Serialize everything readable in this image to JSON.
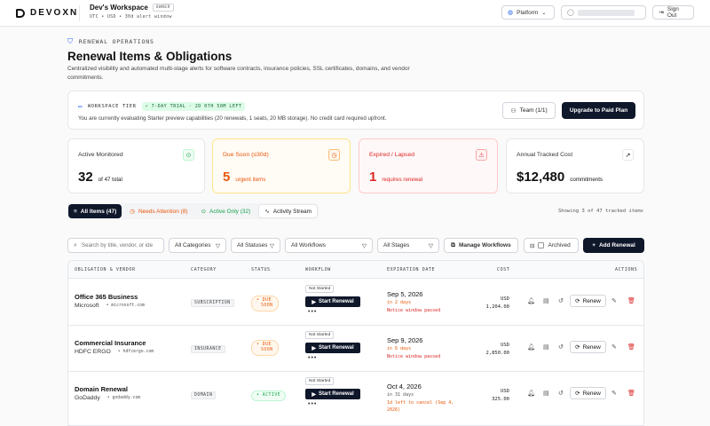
{
  "app": {
    "logo": "DEVOXN",
    "workspace": "Dev's Workspace",
    "role_badge": "OWNER",
    "workspace_sub": "UTC • USD • 30d alert window"
  },
  "header": {
    "platform": "Platform",
    "sign_out": "Sign Out"
  },
  "section_label": "RENEWAL OPERATIONS",
  "page_title": "Renewal Items & Obligations",
  "page_desc": "Centralized visibility and automated multi-stage alerts for software contracts, insurance policies, SSL certificates, domains, and vendor commitments.",
  "tier": {
    "label": "WORKSPACE TIER",
    "trial": "7-DAY TRIAL · 2D 07H 50M LEFT",
    "desc": "You are currently evaluating Starter preview capabilities (20 renewals, 1 seats, 20 MB storage). No credit card required upfront.",
    "team_button": "Team (1/1)",
    "upgrade_button": "Upgrade to Paid Plan"
  },
  "stats": [
    {
      "label": "Active Monitored",
      "value": "32",
      "suffix": "of 47 total"
    },
    {
      "label": "Due Soon (≤30d)",
      "value": "5",
      "suffix": "urgent items"
    },
    {
      "label": "Expired / Lapsed",
      "value": "1",
      "suffix": "requires renewal"
    },
    {
      "label": "Annual Tracked Cost",
      "value": "$12,480",
      "suffix": "commitments"
    }
  ],
  "tabs": [
    {
      "label": "All Items (47)"
    },
    {
      "label": "Needs Attention (8)"
    },
    {
      "label": "Active Only (32)"
    },
    {
      "label": "Activity Stream"
    }
  ],
  "showing": "Showing 3 of 47 tracked items",
  "filters": {
    "search_placeholder": "Search by title, vendor, or ide",
    "categories": "All Categories",
    "statuses": "All Statuses",
    "workflows": "All Workflows",
    "stages": "All Stages",
    "manage_workflows": "Manage Workflows",
    "archived": "Archived",
    "add_renewal": "Add Renewal"
  },
  "table": {
    "headers": {
      "obligation": "OBLIGATION & VENDOR",
      "category": "CATEGORY",
      "status": "STATUS",
      "workflow": "WORKFLOW",
      "expiration": "EXPIRATION DATE",
      "cost": "COST",
      "actions": "ACTIONS"
    },
    "rows": [
      {
        "name": "Office 365 Business",
        "vendor": "Microsoft",
        "domain": "• microsoft.com",
        "category": "SUBSCRIPTION",
        "status_line1": "• DUE",
        "status_line2": "SOON",
        "wf_status": "Not Started",
        "wf_button": "Start Renewal",
        "wf_more": "•••",
        "date": "Sep 5, 2026",
        "in": "in 2 days",
        "note": "Notice window passed",
        "currency": "USD",
        "amount": "1,204.00",
        "renew": "Renew"
      },
      {
        "name": "Commercial Insurance",
        "vendor": "HDFC ERGO",
        "domain": "• hdfcergo.com",
        "category": "INSURANCE",
        "status_line1": "• DUE",
        "status_line2": "SOON",
        "wf_status": "Not Started",
        "wf_button": "Start Renewal",
        "wf_more": "•••",
        "date": "Sep 9, 2026",
        "in": "in 6 days",
        "note": "Notice window passed",
        "currency": "USD",
        "amount": "2,850.00",
        "renew": "Renew"
      },
      {
        "name": "Domain Renewal",
        "vendor": "GoDaddy",
        "domain": "• godaddy.com",
        "category": "DOMAIN",
        "status_line1": "• ACTIVE",
        "status_line2": "",
        "wf_status": "Not Started",
        "wf_button": "Start Renewal",
        "wf_more": "•••",
        "date": "Oct 4, 2026",
        "in": "in 31 days",
        "note": "1d left to cancel (Sep 4, 2026)",
        "currency": "USD",
        "amount": "325.00",
        "renew": "Renew"
      }
    ]
  },
  "colors": {
    "accent_dark": "#0f172a",
    "due_soon": "#ea580c",
    "expired": "#dc2626",
    "active": "#16a34a"
  }
}
